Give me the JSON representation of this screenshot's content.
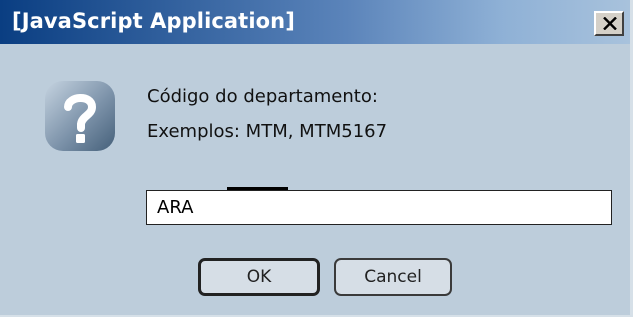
{
  "window": {
    "title": "[JavaScript Application]"
  },
  "icons": {
    "close": "close-icon",
    "question": "question-icon"
  },
  "message": {
    "line1": "Código do departamento:",
    "line2": "Exemplos: MTM, MTM5167"
  },
  "input": {
    "value": "ARA"
  },
  "buttons": {
    "ok_label": "OK",
    "cancel_label": "Cancel"
  },
  "colors": {
    "title_bar_start": "#0a3e82",
    "title_bar_end": "#a8c2dc",
    "dialog_background": "#bdcddb",
    "icon_gradient_light": "#c5d3e0",
    "icon_gradient_dark": "#45607a"
  }
}
